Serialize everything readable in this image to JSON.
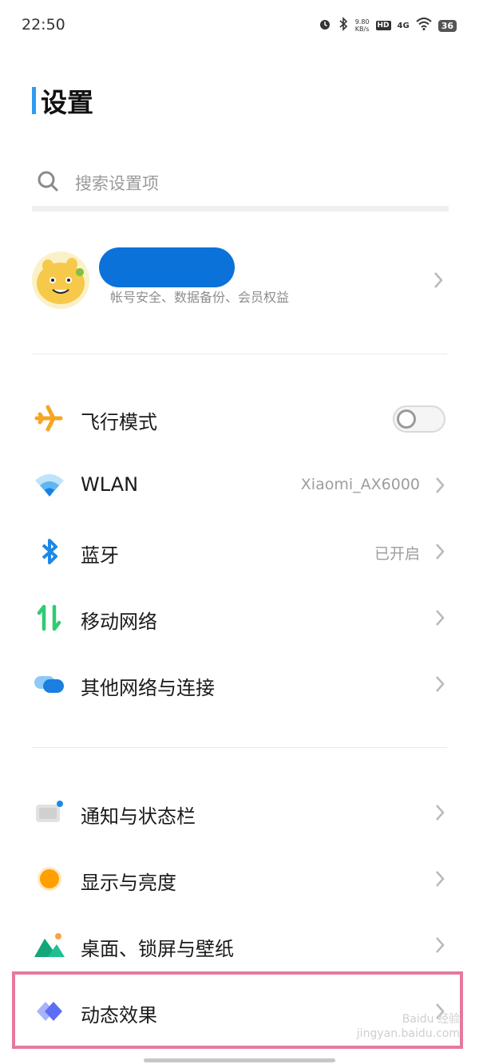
{
  "status_bar": {
    "time": "22:50",
    "net_speed_value": "9.80",
    "net_speed_unit": "KB/s",
    "hd_label": "HD",
    "signal_label": "4G",
    "battery_level": "36",
    "icons": [
      "alarm-icon",
      "bluetooth-icon",
      "hd-icon",
      "signal-4g-icon",
      "wifi-icon",
      "battery-icon"
    ]
  },
  "page": {
    "title": "设置",
    "accent_color": "#2e9bf0"
  },
  "search": {
    "placeholder": "搜索设置项"
  },
  "account": {
    "name": "",
    "subtitle": "帐号安全、数据备份、会员权益"
  },
  "sections": {
    "network": [
      {
        "label": "飞行模式",
        "value": "",
        "type": "toggle",
        "toggle_on": false,
        "icon": "airplane-icon"
      },
      {
        "label": "WLAN",
        "value": "Xiaomi_AX6000",
        "type": "link",
        "icon": "wifi-icon"
      },
      {
        "label": "蓝牙",
        "value": "已开启",
        "type": "link",
        "icon": "bluetooth-icon"
      },
      {
        "label": "移动网络",
        "value": "",
        "type": "link",
        "icon": "mobile-network-icon"
      },
      {
        "label": "其他网络与连接",
        "value": "",
        "type": "link",
        "icon": "other-network-icon"
      }
    ],
    "display": [
      {
        "label": "通知与状态栏",
        "value": "",
        "type": "link",
        "icon": "notification-icon"
      },
      {
        "label": "显示与亮度",
        "value": "",
        "type": "link",
        "icon": "display-brightness-icon"
      },
      {
        "label": "桌面、锁屏与壁纸",
        "value": "",
        "type": "link",
        "icon": "wallpaper-icon"
      },
      {
        "label": "动态效果",
        "value": "",
        "type": "link",
        "icon": "motion-effects-icon",
        "highlighted": true
      }
    ]
  },
  "watermark": {
    "line1": "Baidu 经验",
    "line2": "jingyan.baidu.com"
  },
  "colors": {
    "highlight": "#e57a9e",
    "airplane": "#f5a623",
    "wifi": "#2e9bf0",
    "bluetooth": "#1e88e5",
    "mobile_network": "#2ecc71",
    "display": "#ffa000",
    "motion": "#5b6ef5"
  }
}
